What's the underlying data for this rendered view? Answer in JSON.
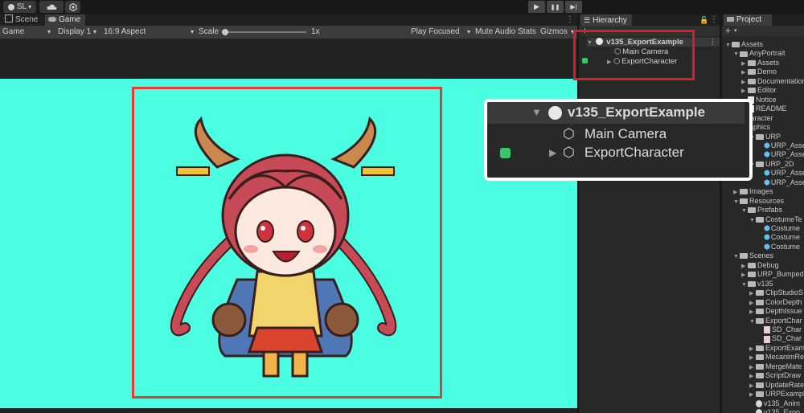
{
  "toolbar": {
    "account_label": "SL",
    "account_dropdown": "▾",
    "cloud_icon": "cloud-icon",
    "collab_icon": "collab-icon",
    "play_glyph": "▶",
    "pause_glyph": "❚❚",
    "step_glyph": "▶|"
  },
  "game_panel": {
    "tabs": [
      {
        "label": "Scene",
        "icon": "scene-icon"
      },
      {
        "label": "Game",
        "icon": "game-icon"
      }
    ],
    "more_glyph": "⋮",
    "display_mode": "Game",
    "display": "Display 1",
    "aspect": "16:9 Aspect",
    "scale_label": "Scale",
    "scale_value": "1x",
    "scale_fraction": 0.0,
    "play_focused": "Play Focused",
    "mute_audio": "Mute Audio",
    "stats": "Stats",
    "gizmos": "Gizmos",
    "dropdown_glyph": "▾",
    "view_color": "#4bfee2",
    "frame_color": "#e43a3a"
  },
  "hierarchy": {
    "tab_label": "Hierarchy",
    "add_glyph": "+",
    "scene_name": "v135_ExportExample",
    "items": [
      {
        "label": "Main Camera"
      },
      {
        "label": "ExportCharacter"
      }
    ]
  },
  "callout": {
    "scene_name": "v135_ExportExample",
    "items": [
      {
        "label": "Main Camera"
      },
      {
        "label": "ExportCharacter"
      }
    ]
  },
  "project": {
    "tab_label": "Project",
    "add_glyph": "+",
    "rows": [
      {
        "label": "Assets",
        "indent": 0,
        "kind": "folder",
        "open": true
      },
      {
        "label": "AnyPortrait",
        "indent": 1,
        "kind": "folder",
        "open": true
      },
      {
        "label": "Assets",
        "indent": 2,
        "kind": "folder",
        "open": false
      },
      {
        "label": "Demo",
        "indent": 2,
        "kind": "folder",
        "open": false
      },
      {
        "label": "Documentation",
        "indent": 2,
        "kind": "folder",
        "open": false
      },
      {
        "label": "Editor",
        "indent": 2,
        "kind": "folder",
        "open": false
      },
      {
        "label": "Notice",
        "indent": 2,
        "kind": "file",
        "open": false
      },
      {
        "label": "README",
        "indent": 2,
        "kind": "file",
        "open": false
      },
      {
        "label": "Character",
        "indent": 0,
        "kind": "folder",
        "open": false
      },
      {
        "label": "Graphics",
        "indent": 0,
        "kind": "folder",
        "open": false
      },
      {
        "label": "URP",
        "indent": 3,
        "kind": "folder",
        "open": true
      },
      {
        "label": "URP_Asset_",
        "indent": 4,
        "kind": "asset",
        "open": false
      },
      {
        "label": "URP_Asset_",
        "indent": 4,
        "kind": "asset",
        "open": false
      },
      {
        "label": "URP_2D",
        "indent": 3,
        "kind": "folder",
        "open": true
      },
      {
        "label": "URP_Asset_",
        "indent": 4,
        "kind": "asset",
        "open": false
      },
      {
        "label": "URP_Asset_",
        "indent": 4,
        "kind": "asset",
        "open": false
      },
      {
        "label": "Images",
        "indent": 1,
        "kind": "folder",
        "open": false
      },
      {
        "label": "Resources",
        "indent": 1,
        "kind": "folder",
        "open": true
      },
      {
        "label": "Prefabs",
        "indent": 2,
        "kind": "folder",
        "open": true
      },
      {
        "label": "CostumeTe",
        "indent": 3,
        "kind": "folder",
        "open": true
      },
      {
        "label": "Costume",
        "indent": 4,
        "kind": "prefab",
        "open": false
      },
      {
        "label": "Costume",
        "indent": 4,
        "kind": "prefab",
        "open": false
      },
      {
        "label": "Costume",
        "indent": 4,
        "kind": "prefab",
        "open": false
      },
      {
        "label": "Scenes",
        "indent": 1,
        "kind": "folder",
        "open": true
      },
      {
        "label": "Debug",
        "indent": 2,
        "kind": "folder",
        "open": false
      },
      {
        "label": "URP_BumpedI",
        "indent": 2,
        "kind": "folder",
        "open": false
      },
      {
        "label": "v135",
        "indent": 2,
        "kind": "folder",
        "open": true
      },
      {
        "label": "ClipStudioS",
        "indent": 3,
        "kind": "folder",
        "open": false
      },
      {
        "label": "ColorDepth",
        "indent": 3,
        "kind": "folder",
        "open": false
      },
      {
        "label": "DepthIssue",
        "indent": 3,
        "kind": "folder",
        "open": false
      },
      {
        "label": "ExportChar",
        "indent": 3,
        "kind": "folder",
        "open": true
      },
      {
        "label": "SD_Char",
        "indent": 4,
        "kind": "image",
        "open": false
      },
      {
        "label": "SD_Char",
        "indent": 4,
        "kind": "image",
        "open": false
      },
      {
        "label": "ExportExam",
        "indent": 3,
        "kind": "folder",
        "open": false
      },
      {
        "label": "MecanimRe",
        "indent": 3,
        "kind": "folder",
        "open": false
      },
      {
        "label": "MergeMate",
        "indent": 3,
        "kind": "folder",
        "open": false
      },
      {
        "label": "ScriptDraw",
        "indent": 3,
        "kind": "folder",
        "open": false
      },
      {
        "label": "UpdateRate",
        "indent": 3,
        "kind": "folder",
        "open": false
      },
      {
        "label": "URPExampl",
        "indent": 3,
        "kind": "folder",
        "open": false
      },
      {
        "label": "v135_Anim",
        "indent": 3,
        "kind": "scene",
        "open": false
      },
      {
        "label": "v135_Expo",
        "indent": 3,
        "kind": "scene",
        "open": false
      }
    ]
  }
}
